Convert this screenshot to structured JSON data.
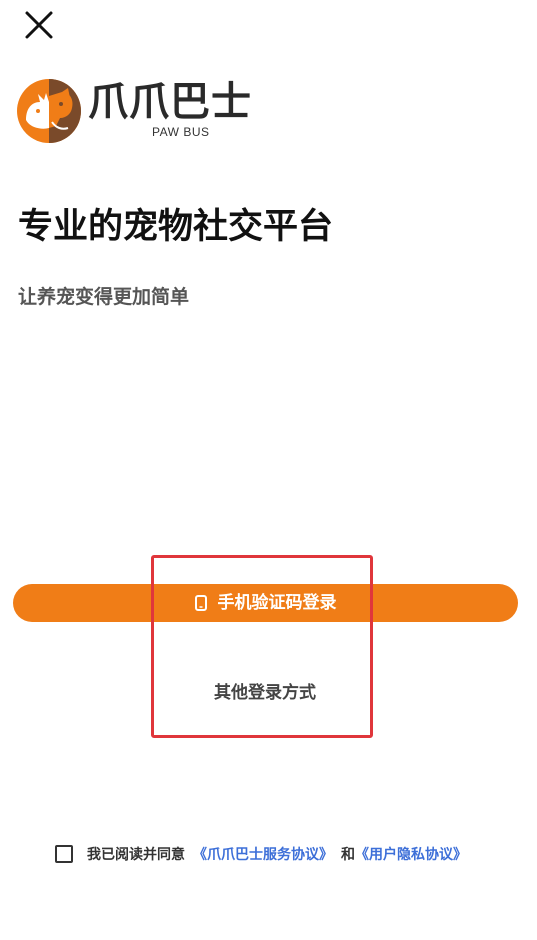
{
  "header": {
    "close_icon": "close-icon"
  },
  "brand": {
    "logo_icon": "paw-bus-logo-icon",
    "name": "爪爪巴士",
    "subtitle": "PAW BUS"
  },
  "hero": {
    "headline": "专业的宠物社交平台",
    "subline": "让养宠变得更加简单"
  },
  "login": {
    "phone_icon": "phone-icon",
    "phone_login_label": "手机验证码登录",
    "other_login_label": "其他登录方式"
  },
  "agreement": {
    "checked": false,
    "prefix": "我已阅读并同意",
    "service_link": "《爪爪巴士服务协议》",
    "conjunction": "和",
    "privacy_link": "《用户隐私协议》"
  },
  "colors": {
    "accent": "#f07d17",
    "logo_brown": "#7a4a2a",
    "highlight": "#e0363b",
    "link": "#3d6fd8"
  }
}
